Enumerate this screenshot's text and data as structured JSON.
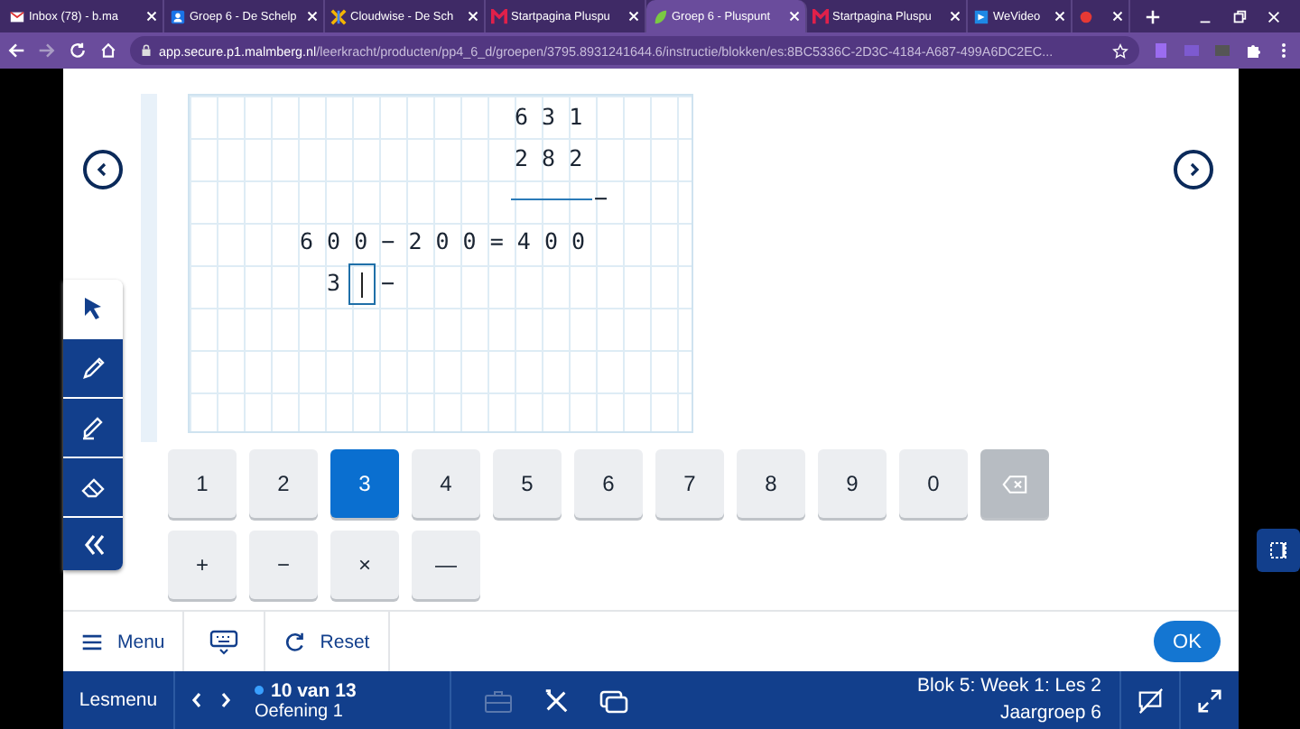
{
  "browser": {
    "tabs": [
      {
        "title": "Inbox (78) - b.ma",
        "selected": false
      },
      {
        "title": "Groep 6 - De Schelp",
        "selected": false
      },
      {
        "title": "Cloudwise - De Sch",
        "selected": false
      },
      {
        "title": "Startpagina Pluspu",
        "selected": false
      },
      {
        "title": "Groep 6 - Pluspunt",
        "selected": true
      },
      {
        "title": "Startpagina Pluspu",
        "selected": false
      },
      {
        "title": "WeVideo",
        "selected": false
      },
      {
        "selected": false
      }
    ],
    "url_host": "app.secure.p1.malmberg.nl",
    "url_path": "/leerkracht/producten/pp4_6_d/groepen/3795.8931241644.6/instructie/blokken/es:8BC5336C-2D3C-4184-A687-499A6DC2EC..."
  },
  "worksheet": {
    "top_number": "6 3 1",
    "bottom_number": "2 8 2",
    "column_operator": "−",
    "equation": "6 0 0 − 2 0 0 = 4 0 0",
    "answer_digit": "3",
    "answer_operator": "−"
  },
  "tools": [
    {
      "kind": "pointer",
      "selected": true
    },
    {
      "kind": "pen",
      "selected": false
    },
    {
      "kind": "marker",
      "selected": false
    },
    {
      "kind": "eraser",
      "selected": false
    },
    {
      "kind": "collapse",
      "selected": false
    }
  ],
  "keypad": {
    "digits": [
      {
        "label": "1",
        "selected": false
      },
      {
        "label": "2",
        "selected": false
      },
      {
        "label": "3",
        "selected": true
      },
      {
        "label": "4",
        "selected": false
      },
      {
        "label": "5",
        "selected": false
      },
      {
        "label": "6",
        "selected": false
      },
      {
        "label": "7",
        "selected": false
      },
      {
        "label": "8",
        "selected": false
      },
      {
        "label": "9",
        "selected": false
      },
      {
        "label": "0",
        "selected": false
      }
    ],
    "operators": [
      {
        "label": "+"
      },
      {
        "label": "−"
      },
      {
        "label": "×"
      },
      {
        "label": "—"
      }
    ]
  },
  "toolbar": {
    "menu": "Menu",
    "reset": "Reset",
    "ok": "OK"
  },
  "footer": {
    "lesmenu": "Lesmenu",
    "progress": "10 van 13",
    "exercise": "Oefening 1",
    "lesson": "Blok 5: Week 1: Les 2",
    "group": "Jaargroep 6"
  }
}
